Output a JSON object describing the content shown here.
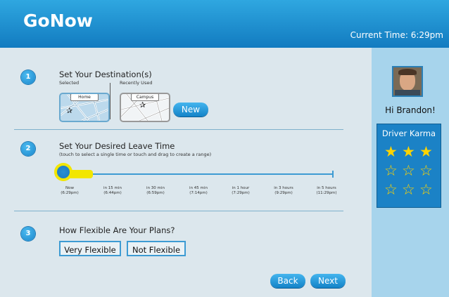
{
  "app": {
    "title": "GoNow",
    "current_time": "Current Time: 6:29pm"
  },
  "steps": [
    {
      "number": "1",
      "title": "Set Your Destination(s)"
    },
    {
      "number": "2",
      "title": "Set Your Desired Leave Time",
      "subtitle": "(touch to select a single time or touch and drag to create a range)"
    },
    {
      "number": "3",
      "title": "How Flexible Are Your Plans?"
    }
  ],
  "destinations": {
    "selected_label": "Selected",
    "recent_label": "Recently Used",
    "selected_card": "Home",
    "recent_card": "Campus",
    "new_button": "New"
  },
  "timeline": {
    "ticks": [
      {
        "line1": "Now",
        "line2": "(6:29pm)"
      },
      {
        "line1": "in 15 min",
        "line2": "(6:44pm)"
      },
      {
        "line1": "in 30 min",
        "line2": "(6:59pm)"
      },
      {
        "line1": "in 45 min",
        "line2": "(7:14pm)"
      },
      {
        "line1": "in 1 hour",
        "line2": "(7:29pm)"
      },
      {
        "line1": "in 3 hours",
        "line2": "(9:29pm)"
      },
      {
        "line1": "in 5 hours",
        "line2": "(11:29pm)"
      }
    ],
    "selected_index": 0
  },
  "flexibility": {
    "options": [
      "Very Flexible",
      "Not Flexible"
    ]
  },
  "nav": {
    "back": "Back",
    "next": "Next"
  },
  "user": {
    "greeting": "Hi Brandon!"
  },
  "karma": {
    "title": "Driver Karma",
    "stars_filled": 3,
    "stars_total": 9
  },
  "colors": {
    "header": "#1a8fd3",
    "accent": "#1b82c6",
    "highlight": "#f2e600"
  }
}
